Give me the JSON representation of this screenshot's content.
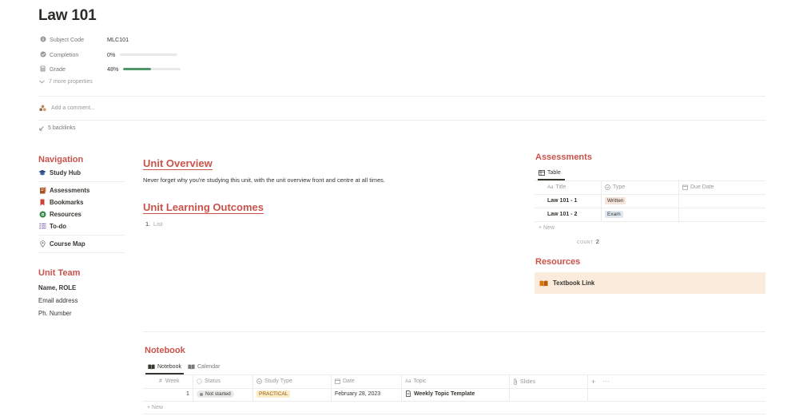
{
  "page": {
    "title": "Law 101"
  },
  "properties": {
    "subject_code": {
      "label": "Subject Code",
      "value": "MLC101"
    },
    "completion": {
      "label": "Completion",
      "value": "0%",
      "fraction": 0.0
    },
    "grade": {
      "label": "Grade",
      "value": "48%",
      "fraction": 0.48
    },
    "more": "7 more properties"
  },
  "comment": {
    "placeholder": "Add a comment..."
  },
  "backlinks": {
    "label": "5 backlinks"
  },
  "navigation": {
    "heading": "Navigation",
    "items": [
      {
        "label": "Study Hub",
        "icon": "graduation-cap-icon"
      },
      {
        "label": "Assessments",
        "icon": "notebook-icon"
      },
      {
        "label": "Bookmarks",
        "icon": "bookmark-icon"
      },
      {
        "label": "Resources",
        "icon": "gear-icon"
      },
      {
        "label": "To-do",
        "icon": "list-icon"
      },
      {
        "label": "Course Map",
        "icon": "pin-icon"
      }
    ]
  },
  "unit_team": {
    "heading": "Unit Team",
    "name": "Name, ROLE",
    "email": "Email address",
    "phone": "Ph. Number"
  },
  "overview": {
    "heading": "Unit Overview",
    "text": "Never forget why you're studying this unit, with the unit overview front and centre at all times."
  },
  "outcomes": {
    "heading": "Unit Learning Outcomes",
    "list_number": "1.",
    "list_placeholder": "List"
  },
  "assessments": {
    "heading": "Assessments",
    "view": "Table",
    "columns": [
      "Title",
      "Type",
      "Due Date"
    ],
    "title_prefix": "Aa",
    "rows": [
      {
        "title": "Law 101 - 1",
        "type": "Written",
        "type_color": "#f4e4d9"
      },
      {
        "title": "Law 101 - 2",
        "type": "Exam",
        "type_color": "#dde8f0"
      }
    ],
    "new_label": "New",
    "count_label": "COUNT",
    "count_value": "2"
  },
  "resources": {
    "heading": "Resources",
    "link": "Textbook Link",
    "bg_color": "#faebdd"
  },
  "notebook": {
    "heading": "Notebook",
    "tabs": [
      "Notebook",
      "Calendar"
    ],
    "columns": [
      "Week",
      "Status",
      "Study Type",
      "Date",
      "Topic",
      "Slides"
    ],
    "week_prefix": "#",
    "topic_prefix": "Aa",
    "row": {
      "week": "1",
      "status": "Not started",
      "study_type": "PRACTICAL",
      "study_type_color": "#fdecc8",
      "date": "February 28, 2023",
      "topic": "Weekly Topic Template"
    },
    "new_label": "New"
  },
  "colors": {
    "accent_red": "#c9524a",
    "progress_green": "#4f9768"
  }
}
